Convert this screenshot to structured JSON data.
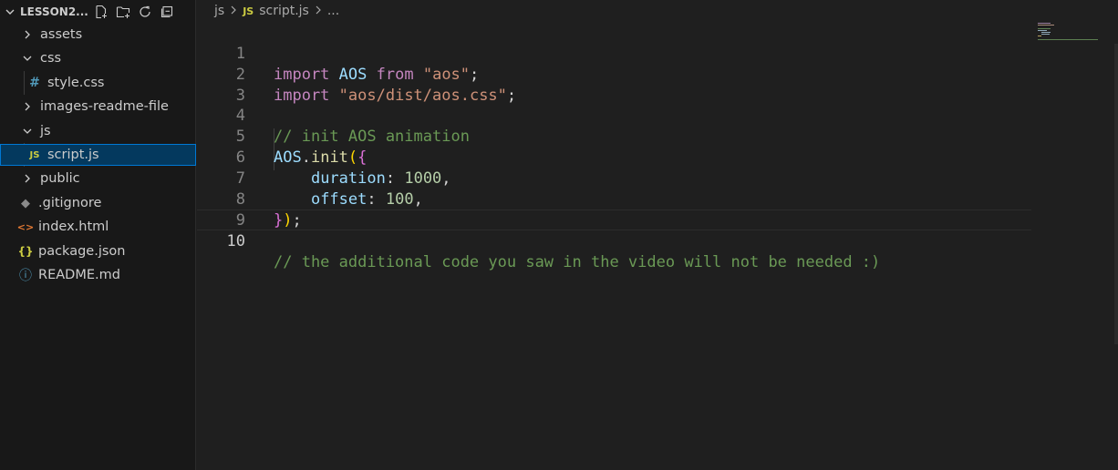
{
  "explorer": {
    "root": "LESSON2...",
    "items": [
      {
        "label": "assets",
        "kind": "folder-closed",
        "icon": "chevron-right-icon"
      },
      {
        "label": "css",
        "kind": "folder-open",
        "icon": "chevron-down-icon"
      },
      {
        "label": "style.css",
        "kind": "file",
        "icon": "css-file-icon",
        "glyph": "#"
      },
      {
        "label": "images-readme-file",
        "kind": "folder-closed",
        "icon": "chevron-right-icon"
      },
      {
        "label": "js",
        "kind": "folder-open",
        "icon": "chevron-down-icon"
      },
      {
        "label": "script.js",
        "kind": "file",
        "icon": "js-file-icon",
        "glyph": "JS",
        "selected": true
      },
      {
        "label": "public",
        "kind": "folder-closed",
        "icon": "chevron-right-icon"
      },
      {
        "label": ".gitignore",
        "kind": "file",
        "icon": "git-file-icon",
        "glyph": "◆"
      },
      {
        "label": "index.html",
        "kind": "file",
        "icon": "html-file-icon",
        "glyph": "<>"
      },
      {
        "label": "package.json",
        "kind": "file",
        "icon": "json-file-icon",
        "glyph": "{}"
      },
      {
        "label": "README.md",
        "kind": "file",
        "icon": "info-file-icon",
        "glyph": "ⓘ"
      }
    ]
  },
  "breadcrumb": {
    "folder": "js",
    "file_badge": "JS",
    "file": "script.js",
    "ellipsis": "..."
  },
  "editor": {
    "active_line": 10,
    "lines": [
      {
        "n": "1"
      },
      {
        "n": "2"
      },
      {
        "n": "3"
      },
      {
        "n": "4"
      },
      {
        "n": "5"
      },
      {
        "n": "6"
      },
      {
        "n": "7"
      },
      {
        "n": "8"
      },
      {
        "n": "9"
      },
      {
        "n": "10"
      }
    ],
    "tokens": {
      "import": "import",
      "aos": "AOS",
      "from": "from",
      "aos_str": "\"aos\"",
      "semi": ";",
      "css_str": "\"aos/dist/aos.css\"",
      "comment1": "// init AOS animation",
      "init": "init",
      "dot": ".",
      "open_paren": "(",
      "open_brace": "{",
      "duration": "duration",
      "colon": ":",
      "duration_val": "1000",
      "comma": ",",
      "offset": "offset",
      "offset_val": "100",
      "close_brace": "}",
      "close_paren": ")",
      "comment2": "// the additional code you saw in the video will not be needed :)"
    }
  },
  "colors": {
    "keyword": "#c586c0",
    "identifier": "#9cdcfe",
    "string": "#ce9178",
    "comment": "#6a9955",
    "number": "#b5cea8",
    "function": "#dcdcaa",
    "selection": "#04395e"
  }
}
